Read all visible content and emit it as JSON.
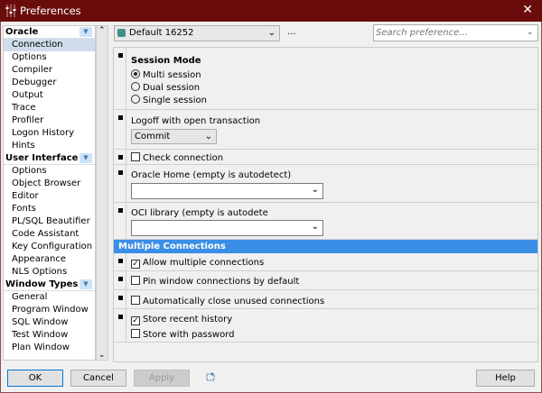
{
  "window": {
    "title": "Preferences",
    "close": "✕"
  },
  "tree": {
    "sections": [
      {
        "label": "Oracle",
        "items": [
          "Connection",
          "Options",
          "Compiler",
          "Debugger",
          "Output",
          "Trace",
          "Profiler",
          "Logon History",
          "Hints"
        ]
      },
      {
        "label": "User Interface",
        "items": [
          "Options",
          "Object Browser",
          "Editor",
          "Fonts",
          "PL/SQL Beautifier",
          "Code Assistant",
          "Key Configuration",
          "Appearance",
          "NLS Options"
        ]
      },
      {
        "label": "Window Types",
        "items": [
          "General",
          "Program Window",
          "SQL Window",
          "Test Window",
          "Plan Window"
        ]
      }
    ],
    "selected": "Connection"
  },
  "toolbar": {
    "profile": "Default 16252",
    "more": "...",
    "search_placeholder": "Search preference..."
  },
  "session": {
    "title": "Session Mode",
    "options": [
      "Multi session",
      "Dual session",
      "Single session"
    ],
    "selected": "Multi session"
  },
  "logoff": {
    "label": "Logoff with open transaction",
    "value": "Commit"
  },
  "check_connection": {
    "label": "Check connection",
    "checked": false
  },
  "oracle_home": {
    "label": "Oracle Home (empty is autodetect)",
    "value": ""
  },
  "oci": {
    "label": "OCI library (empty is autodete",
    "value": ""
  },
  "multiple": {
    "header": "Multiple Connections",
    "allow": {
      "label": "Allow multiple connections",
      "checked": true
    },
    "pin": {
      "label": "Pin window connections by default",
      "checked": false
    },
    "autoclose": {
      "label": "Automatically close unused connections",
      "checked": false
    },
    "history": {
      "label": "Store recent history",
      "checked": true
    },
    "password": {
      "label": "Store with password",
      "checked": false
    }
  },
  "buttons": {
    "ok": "OK",
    "cancel": "Cancel",
    "apply": "Apply",
    "help": "Help"
  },
  "check_glyph": "✓"
}
